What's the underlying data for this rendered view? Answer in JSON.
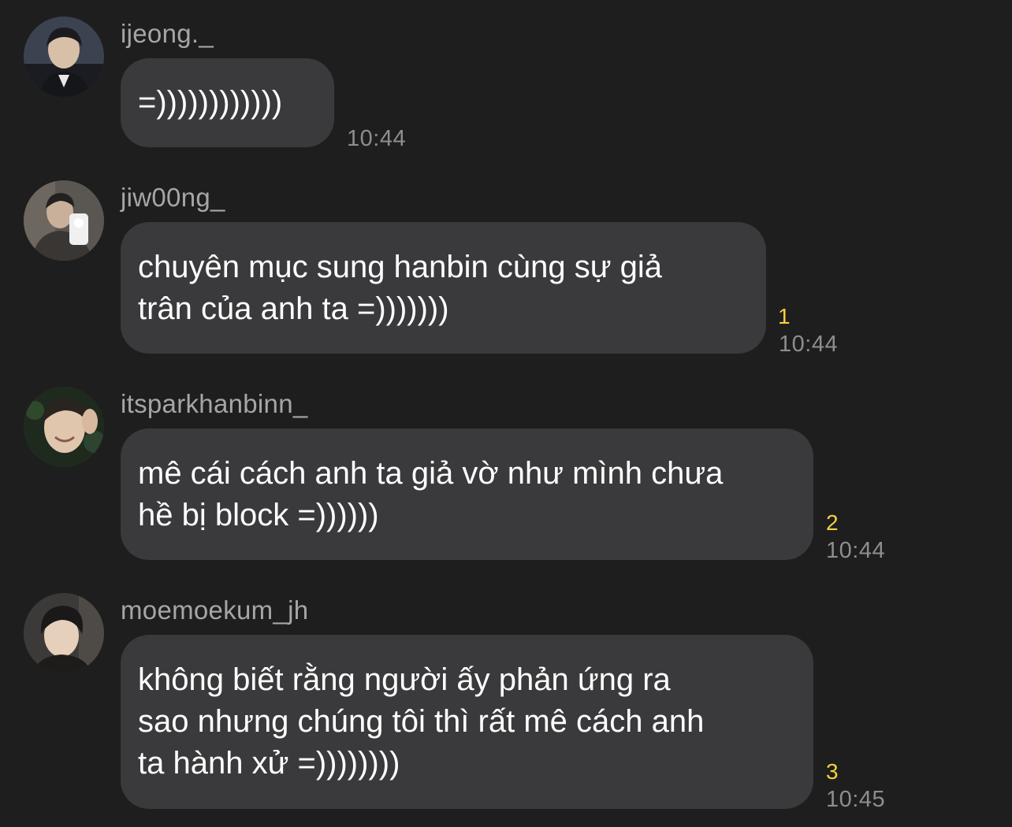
{
  "messages": [
    {
      "username": "ijeong._",
      "text": "=))))))))))))",
      "read_count": "",
      "time": "10:44",
      "avatar_icon": "user-avatar-icon"
    },
    {
      "username": "jiw00ng_",
      "text": "chuyên mục sung hanbin cùng sự giả\ntrân của anh ta =)))))))",
      "read_count": "1",
      "time": "10:44",
      "avatar_icon": "user-avatar-icon"
    },
    {
      "username": "itsparkhanbinn_",
      "text": "mê cái cách anh ta giả vờ như mình chưa\nhề bị block =))))))",
      "read_count": "2",
      "time": "10:44",
      "avatar_icon": "user-avatar-icon"
    },
    {
      "username": "moemoekum_jh",
      "text": "không biết rằng người ấy phản ứng ra\nsao nhưng chúng tôi thì rất mê cách anh\nta hành xử =))))))))",
      "read_count": "3",
      "time": "10:45",
      "avatar_icon": "user-avatar-icon"
    }
  ],
  "colors": {
    "background": "#1e1e1f",
    "bubble": "#3a3a3c",
    "username": "#a6a6a8",
    "read_count": "#f5d03c",
    "time": "#8e8e90"
  }
}
